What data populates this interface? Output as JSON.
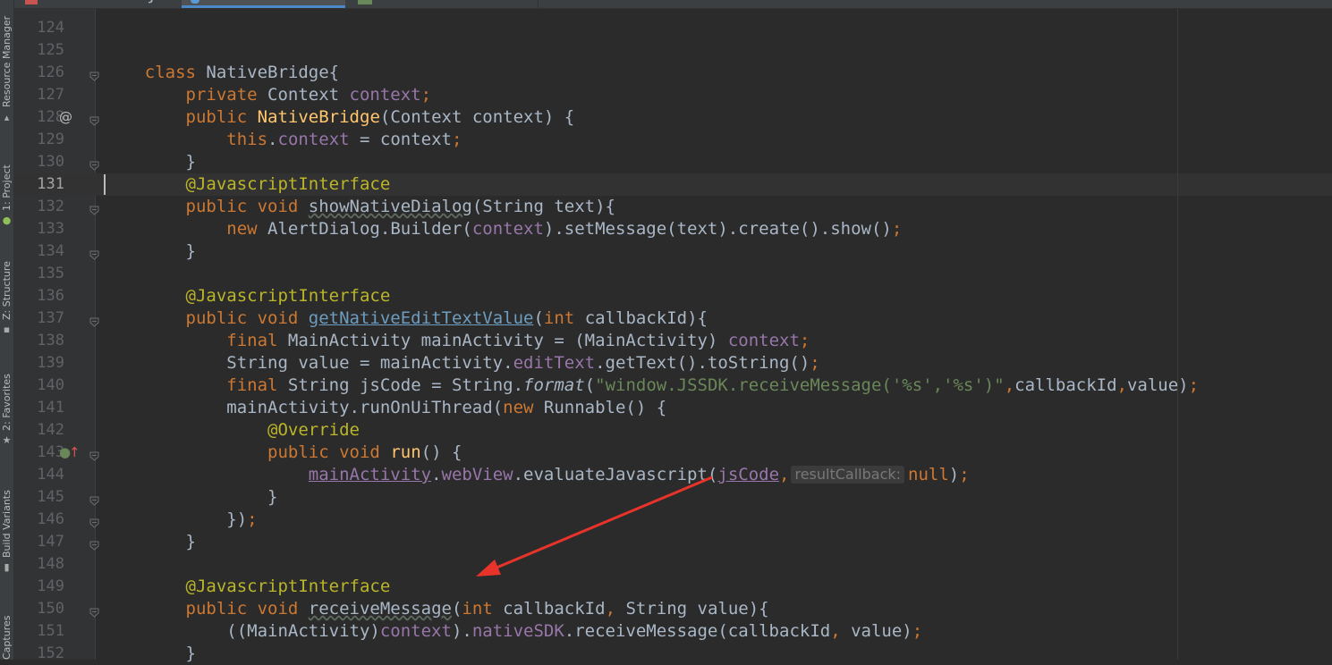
{
  "sidebar": {
    "tabs": [
      {
        "id": "resource-manager",
        "label": "Resource Manager"
      },
      {
        "id": "project",
        "label": "1: Project"
      },
      {
        "id": "structure",
        "label": "Z: Structure"
      },
      {
        "id": "favorites",
        "label": "2: Favorites"
      },
      {
        "id": "build-variants",
        "label": "Build Variants"
      },
      {
        "id": "captures",
        "label": "Captures"
      }
    ]
  },
  "editor": {
    "current_line": "131",
    "partial_top_line": "123",
    "lines": [
      {
        "n": "124",
        "tokens": []
      },
      {
        "n": "125",
        "tokens": []
      },
      {
        "n": "126",
        "tokens": [
          {
            "t": "    "
          },
          {
            "t": "class ",
            "c": "kw"
          },
          {
            "t": "NativeBridge{"
          }
        ]
      },
      {
        "n": "127",
        "tokens": [
          {
            "t": "        "
          },
          {
            "t": "private ",
            "c": "kw"
          },
          {
            "t": "Context "
          },
          {
            "t": "context",
            "c": "fld"
          },
          {
            "t": ";",
            "c": "kw"
          }
        ]
      },
      {
        "n": "128",
        "tokens": [
          {
            "t": "        "
          },
          {
            "t": "public",
            "c": "kw"
          },
          {
            "t": " "
          },
          {
            "t": "NativeBridge",
            "c": "fn"
          },
          {
            "t": "(Context context) {"
          }
        ]
      },
      {
        "n": "129",
        "tokens": [
          {
            "t": "            "
          },
          {
            "t": "this",
            "c": "kw"
          },
          {
            "t": "."
          },
          {
            "t": "context",
            "c": "fld"
          },
          {
            "t": " = context"
          },
          {
            "t": ";",
            "c": "kw"
          }
        ]
      },
      {
        "n": "130",
        "tokens": [
          {
            "t": "        }"
          }
        ]
      },
      {
        "n": "131",
        "tokens": [
          {
            "t": "        "
          },
          {
            "t": "@JavascriptInterface",
            "c": "ann"
          }
        ]
      },
      {
        "n": "132",
        "tokens": [
          {
            "t": "        "
          },
          {
            "t": "public void ",
            "c": "kw"
          },
          {
            "t": "showNativeDialog",
            "c": "dim"
          },
          {
            "t": "(String text){"
          }
        ]
      },
      {
        "n": "133",
        "tokens": [
          {
            "t": "            "
          },
          {
            "t": "new ",
            "c": "kw"
          },
          {
            "t": "AlertDialog.Builder("
          },
          {
            "t": "context",
            "c": "fld"
          },
          {
            "t": ").setMessage(text).create().show()"
          },
          {
            "t": ";",
            "c": "kw"
          }
        ]
      },
      {
        "n": "134",
        "tokens": [
          {
            "t": "        }"
          }
        ]
      },
      {
        "n": "135",
        "tokens": []
      },
      {
        "n": "136",
        "tokens": [
          {
            "t": "        "
          },
          {
            "t": "@JavascriptInterface",
            "c": "ann"
          }
        ]
      },
      {
        "n": "137",
        "tokens": [
          {
            "t": "        "
          },
          {
            "t": "public void ",
            "c": "kw"
          },
          {
            "t": "getNativeEditTextValue",
            "c": "link"
          },
          {
            "t": "("
          },
          {
            "t": "int ",
            "c": "kw"
          },
          {
            "t": "callbackId){"
          }
        ]
      },
      {
        "n": "138",
        "tokens": [
          {
            "t": "            "
          },
          {
            "t": "final ",
            "c": "kw"
          },
          {
            "t": "MainActivity mainActivity = (MainActivity) "
          },
          {
            "t": "context",
            "c": "fld"
          },
          {
            "t": ";",
            "c": "kw"
          }
        ]
      },
      {
        "n": "139",
        "tokens": [
          {
            "t": "            String value = mainActivity."
          },
          {
            "t": "editText",
            "c": "fld"
          },
          {
            "t": ".getText().toString()"
          },
          {
            "t": ";",
            "c": "kw"
          }
        ]
      },
      {
        "n": "140",
        "tokens": [
          {
            "t": "            "
          },
          {
            "t": "final ",
            "c": "kw"
          },
          {
            "t": "String jsCode = String."
          },
          {
            "t": "format",
            "i": true
          },
          {
            "t": "("
          },
          {
            "t": "\"window.JSSDK.receiveMessage('%s','%s')\"",
            "c": "str"
          },
          {
            "t": ",",
            "c": "kw"
          },
          {
            "t": "callbackId"
          },
          {
            "t": ",",
            "c": "kw"
          },
          {
            "t": "value)"
          },
          {
            "t": ";",
            "c": "kw"
          }
        ]
      },
      {
        "n": "141",
        "tokens": [
          {
            "t": "            mainActivity.runOnUiThread("
          },
          {
            "t": "new ",
            "c": "kw"
          },
          {
            "t": "Runnable() {"
          }
        ]
      },
      {
        "n": "142",
        "tokens": [
          {
            "t": "                "
          },
          {
            "t": "@Override",
            "c": "ann"
          }
        ]
      },
      {
        "n": "143",
        "tokens": [
          {
            "t": "                "
          },
          {
            "t": "public void ",
            "c": "kw"
          },
          {
            "t": "run",
            "c": "fn"
          },
          {
            "t": "() {"
          }
        ]
      },
      {
        "n": "144",
        "tokens": [
          {
            "t": "                    "
          },
          {
            "t": "mainActivity",
            "c": "ref"
          },
          {
            "t": "."
          },
          {
            "t": "webView",
            "c": "fld"
          },
          {
            "t": ".evaluateJavascript("
          },
          {
            "t": "jsCode",
            "c": "ref"
          },
          {
            "t": ",",
            "c": "kw"
          },
          {
            "hint": "resultCallback:"
          },
          {
            "t": "null",
            "c": "kw"
          },
          {
            "t": ")"
          },
          {
            "t": ";",
            "c": "kw"
          }
        ]
      },
      {
        "n": "145",
        "tokens": [
          {
            "t": "                }"
          }
        ]
      },
      {
        "n": "146",
        "tokens": [
          {
            "t": "            })"
          },
          {
            "t": ";",
            "c": "kw"
          }
        ]
      },
      {
        "n": "147",
        "tokens": [
          {
            "t": "        }"
          }
        ]
      },
      {
        "n": "148",
        "tokens": []
      },
      {
        "n": "149",
        "tokens": [
          {
            "t": "        "
          },
          {
            "t": "@JavascriptInterface",
            "c": "ann"
          }
        ]
      },
      {
        "n": "150",
        "tokens": [
          {
            "t": "        "
          },
          {
            "t": "public void ",
            "c": "kw"
          },
          {
            "t": "receiveMessage",
            "c": "dim"
          },
          {
            "t": "("
          },
          {
            "t": "int ",
            "c": "kw"
          },
          {
            "t": "callbackId"
          },
          {
            "t": ", ",
            "c": "kw"
          },
          {
            "t": "String value){"
          }
        ]
      },
      {
        "n": "151",
        "tokens": [
          {
            "t": "            ((MainActivity)"
          },
          {
            "t": "context",
            "c": "fld"
          },
          {
            "t": ")."
          },
          {
            "t": "nativeSDK",
            "c": "fld"
          },
          {
            "t": ".receiveMessage(callbackId"
          },
          {
            "t": ", ",
            "c": "kw"
          },
          {
            "t": "value)"
          },
          {
            "t": ";",
            "c": "kw"
          }
        ]
      },
      {
        "n": "152",
        "tokens": [
          {
            "t": "        }"
          }
        ]
      }
    ],
    "gutter_marks": {
      "128": {
        "glyph": "@",
        "color": "#bbbbbb",
        "name": "implements-marker-icon"
      },
      "143": {
        "glyph": "●",
        "color": "#6a8759",
        "name": "override-marker-icon",
        "arrow": "↑",
        "arrow_color": "#d9534f"
      }
    },
    "fold_lines": [
      "126",
      "128",
      "130",
      "132",
      "134",
      "137",
      "143",
      "145",
      "146",
      "147",
      "150"
    ]
  },
  "annotation": {
    "color": "#e8332a"
  },
  "colors": {
    "background": "#2b2b2b",
    "gutter": "#313335",
    "current_line": "#323232"
  }
}
